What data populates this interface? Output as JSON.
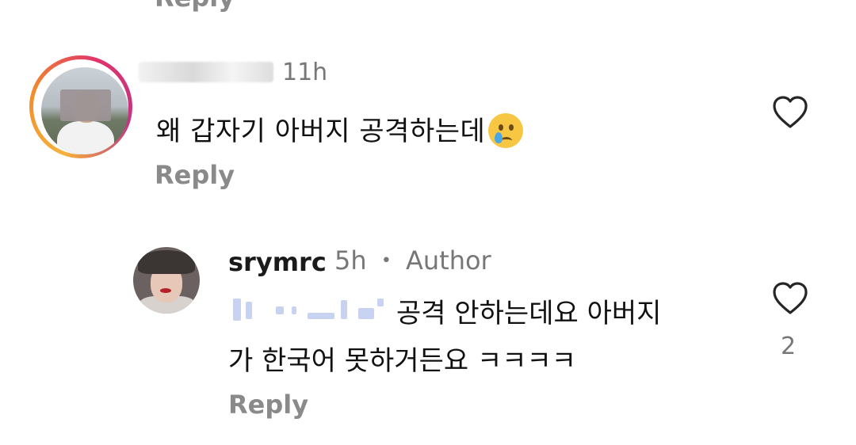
{
  "top_fragment": {
    "text": "Reply"
  },
  "comments": [
    {
      "username": "",
      "time": "11h",
      "text": "왜 갑자기 아버지 공격하는데",
      "emoji": "crying-face-icon",
      "reply_label": "Reply"
    },
    {
      "username": "srymrc",
      "time": "5h",
      "badge": "Author",
      "text_line1": "공격 안하는데요 아버지",
      "text_line2": "가 한국어 못하거든요 ㅋㅋㅋㅋ",
      "like_count": "2",
      "reply_label": "Reply"
    }
  ],
  "icons": {
    "like": "heart-outline-icon"
  },
  "colors": {
    "muted_text": "#8a8a8a",
    "story_ring": "#e0336b"
  }
}
